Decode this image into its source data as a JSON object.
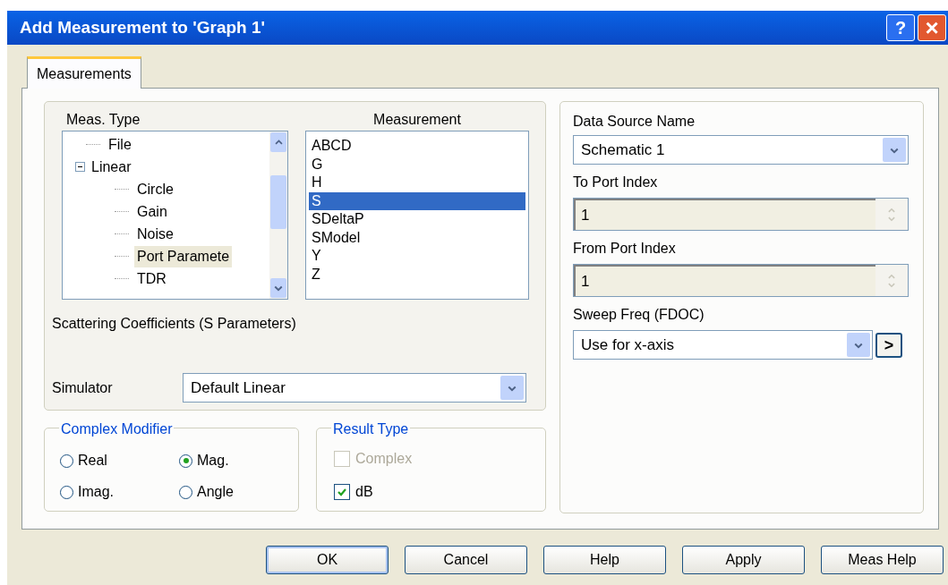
{
  "window": {
    "title": "Add Measurement to 'Graph 1'",
    "help_button": "?",
    "close_button": "×"
  },
  "tabs": [
    {
      "label": "Measurements",
      "selected": true
    }
  ],
  "meas_type": {
    "label": "Meas. Type",
    "tree": [
      {
        "label": "File",
        "selected": false
      },
      {
        "label": "Linear",
        "selected": false,
        "expanded": true,
        "children": [
          {
            "label": "Circle",
            "selected": false
          },
          {
            "label": "Gain",
            "selected": false
          },
          {
            "label": "Noise",
            "selected": false
          },
          {
            "label": "Port Paramete",
            "selected": true
          },
          {
            "label": "TDR",
            "selected": false
          }
        ]
      }
    ]
  },
  "measurement": {
    "label": "Measurement",
    "items": [
      {
        "label": "ABCD",
        "selected": false
      },
      {
        "label": "G",
        "selected": false
      },
      {
        "label": "H",
        "selected": false
      },
      {
        "label": "S",
        "selected": true
      },
      {
        "label": "SDeltaP",
        "selected": false
      },
      {
        "label": "SModel",
        "selected": false
      },
      {
        "label": "Y",
        "selected": false
      },
      {
        "label": "Z",
        "selected": false
      }
    ]
  },
  "description": "Scattering Coefficients (S Parameters)",
  "simulator": {
    "label": "Simulator",
    "value": "Default Linear"
  },
  "complex_modifier": {
    "title": "Complex Modifier",
    "options": [
      {
        "label": "Real",
        "selected": false
      },
      {
        "label": "Mag.",
        "selected": true
      },
      {
        "label": "Imag.",
        "selected": false
      },
      {
        "label": "Angle",
        "selected": false
      }
    ]
  },
  "result_type": {
    "title": "Result Type",
    "options": [
      {
        "label": "Complex",
        "checked": false,
        "disabled": true
      },
      {
        "label": "dB",
        "checked": true,
        "disabled": false
      }
    ]
  },
  "data_source": {
    "label": "Data Source Name",
    "value": "Schematic 1"
  },
  "to_port": {
    "label": "To Port Index",
    "value": "1",
    "disabled": true
  },
  "from_port": {
    "label": "From Port Index",
    "value": "1",
    "disabled": true
  },
  "sweep": {
    "label": "Sweep Freq (FDOC)",
    "value": "Use for x-axis",
    "button": ">"
  },
  "buttons": [
    {
      "label": "OK",
      "default": true
    },
    {
      "label": "Cancel",
      "default": false
    },
    {
      "label": "Help",
      "default": false
    },
    {
      "label": "Apply",
      "default": false
    },
    {
      "label": "Meas Help",
      "default": false
    }
  ]
}
